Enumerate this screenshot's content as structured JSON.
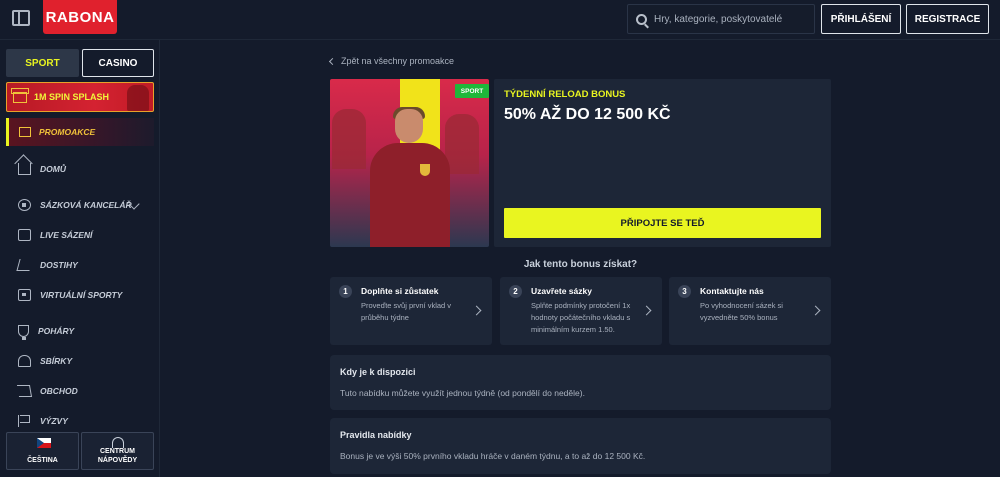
{
  "header": {
    "logo": "RABONA",
    "search_placeholder": "Hry, kategorie, poskytovatelé",
    "login_label": "PŘIHLÁŠENÍ",
    "register_label": "REGISTRACE"
  },
  "sidebar": {
    "tabs": [
      "SPORT",
      "CASINO"
    ],
    "spin_banner": "1M SPIN SPLASH",
    "promo_label": "PROMOAKCE",
    "items": [
      {
        "label": "DOMŮ",
        "icon": "home-icon"
      },
      {
        "label": "SÁZKOVÁ KANCELÁŘ",
        "icon": "ball-icon"
      },
      {
        "label": "LIVE SÁZENÍ",
        "icon": "live-icon"
      },
      {
        "label": "DOSTIHY",
        "icon": "horse-icon"
      },
      {
        "label": "VIRTUÁLNÍ SPORTY",
        "icon": "virtual-icon"
      },
      {
        "label": "POHÁRY",
        "icon": "trophy-icon"
      },
      {
        "label": "SBÍRKY",
        "icon": "collections-icon"
      },
      {
        "label": "OBCHOD",
        "icon": "cart-icon"
      },
      {
        "label": "VÝZVY",
        "icon": "flag-icon"
      }
    ],
    "language_label": "ČEŠTINA",
    "help_label_1": "CENTRUM",
    "help_label_2": "NÁPOVĚDY"
  },
  "main": {
    "back_link": "Zpět na všechny promoakce",
    "sport_tag": "SPORT",
    "promo_label": "TÝDENNÍ RELOAD BONUS",
    "promo_title": "50% AŽ DO 12 500 KČ",
    "join_button": "PŘIPOJTE SE TEĎ",
    "how_title": "Jak tento bonus získat?",
    "steps": [
      {
        "num": "1",
        "title": "Doplňte si zůstatek",
        "desc": "Proveďte svůj první vklad v průběhu týdne"
      },
      {
        "num": "2",
        "title": "Uzavřete sázky",
        "desc": "Splňte podmínky protočení 1x hodnoty počátečního vkladu s minimálním kurzem 1.50."
      },
      {
        "num": "3",
        "title": "Kontaktujte nás",
        "desc": "Po vyhodnocení sázek si vyzvedněte 50% bonus"
      }
    ],
    "availability_title": "Kdy je k dispozici",
    "availability_text": "Tuto nabídku můžete využít jednou týdně (od pondělí do neděle).",
    "rules_title": "Pravidla nabídky",
    "rules_text": "Bonus je ve výši 50% prvního vkladu hráče v daném týdnu, a to až do 12 500 Kč."
  },
  "colors": {
    "accent": "#e9f520",
    "brand": "#e0212d",
    "background": "#141b2b",
    "card": "#1d2637"
  }
}
